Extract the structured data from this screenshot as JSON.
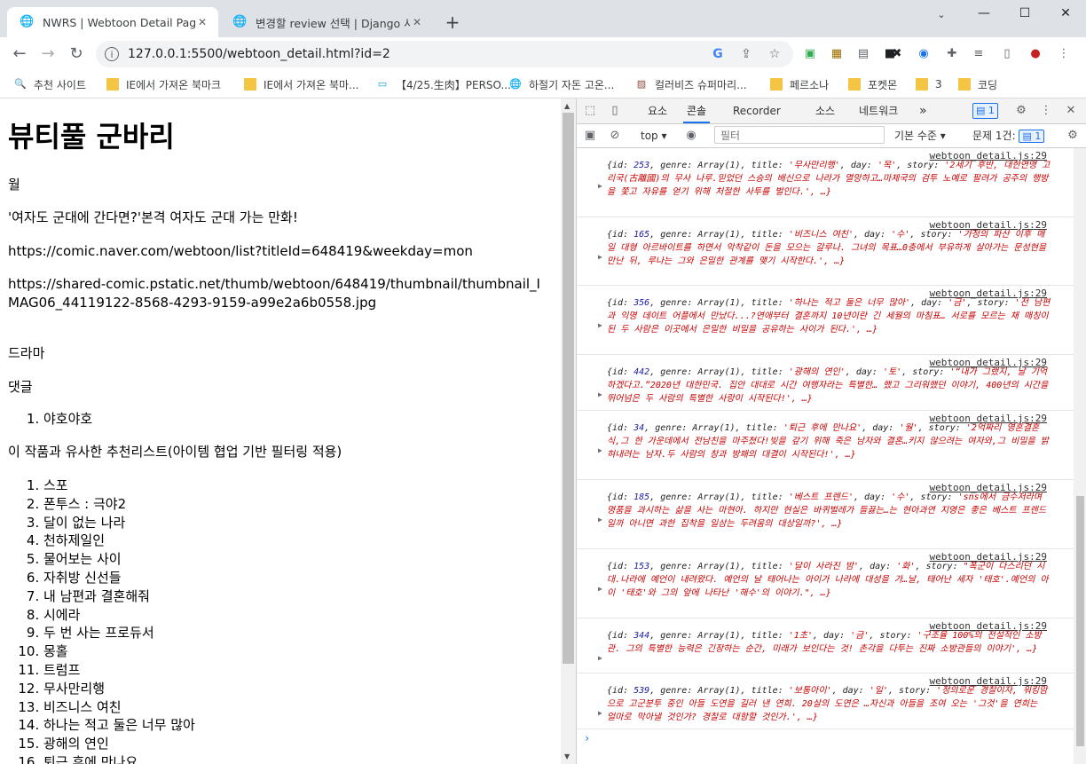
{
  "browser": {
    "tabs": [
      {
        "title": "NWRS | Webtoon Detail Page",
        "icon": "globe-icon",
        "active": true
      },
      {
        "title": "변경할 review 선택 | Django 사이트",
        "icon": "globe-icon",
        "active": false
      }
    ],
    "new_tab_symbol": "+",
    "window_controls": {
      "minimize": "—",
      "maximize": "☐",
      "close": "✕"
    },
    "url": "127.0.0.1:5500/webtoon_detail.html?id=2"
  },
  "bookmarks": [
    {
      "label": "추천 사이트",
      "icon": "search-icon"
    },
    {
      "label": "IE에서 가져온 북마크",
      "icon": "folder-icon"
    },
    {
      "label": "IE에서 가져온 북마...",
      "icon": "folder-icon"
    },
    {
      "label": "【4/25.生肉】PERSO...",
      "icon": "bilibili-icon"
    },
    {
      "label": "하절기 자돈 고온...",
      "icon": "globe-icon"
    },
    {
      "label": "컬러비즈 슈퍼마리...",
      "icon": "image-icon"
    },
    {
      "label": "페르소나",
      "icon": "folder-icon"
    },
    {
      "label": "포켓몬",
      "icon": "folder-icon"
    },
    {
      "label": "3",
      "icon": "folder-icon"
    },
    {
      "label": "코딩",
      "icon": "folder-icon"
    }
  ],
  "page": {
    "title": "뷰티풀 군바리",
    "day": "월",
    "story": "'여자도 군대에 간다면?'본격 여자도 군대 가는 만화!",
    "link": "https://comic.naver.com/webtoon/list?titleId=648419&weekday=mon",
    "thumbnail": "https://shared-comic.pstatic.net/thumb/webtoon/648419/thumbnail/thumbnail_IMAG06_44119122-8568-4293-9159-a99e2a6b0558.jpg",
    "genre": "드라마",
    "comments_heading": "댓글",
    "comments": [
      "야호야호"
    ],
    "recommend_heading": "이 작품과 유사한 추천리스트(아이템 협업 기반 필터링 적용)",
    "recommendations": [
      "스포",
      "폰투스 : 극야2",
      "달이 없는 나라",
      "천하제일인",
      "물어보는 사이",
      "자취방 신선들",
      "내 남편과 결혼해줘",
      "시에라",
      "두 번 사는 프로듀서",
      "몽홀",
      "트럼프",
      "무사만리행",
      "비즈니스 여친",
      "하나는 적고 둘은 너무 많아",
      "광해의 연인",
      "퇴근 후에 만나요"
    ]
  },
  "devtools": {
    "tabs": [
      "요소",
      "콘솔",
      "Recorder",
      "소스",
      "네트워크"
    ],
    "active_tab": "콘솔",
    "more_symbol": "»",
    "issue_count": "1",
    "context": "top",
    "filter_placeholder": "필터",
    "level": "기본 수준",
    "issues_label": "문제 1건:",
    "issues_count": "1",
    "prompt_symbol": "›",
    "console_entries": [
      {
        "source": "webtoon_detail.js:29",
        "id": "253",
        "genre": "Array(1)",
        "title": "'무사만리행'",
        "day": "'목'",
        "story": "'2세기 후반, 대한연맹 고리국(古離國)의 무사 나루.믿었던 스승의 배신으로 나라가 멸망하고…마제국의 검투 노예로 팔려가 공주의 행방을 쫓고 자유를 얻기 위해 처절한 사투를 벌인다.', …}"
      },
      {
        "source": "webtoon_detail.js:29",
        "id": "165",
        "genre": "Array(1)",
        "title": "'비즈니스 여친'",
        "day": "'수'",
        "story": "'가정의 파산 이후 매일 대형 아르바이트를 하면서 악착같이 돈을 모으는 갈루나. 그녀의 목표…0충에서 부유하게 살아가는 문성현을 만난 뒤, 루나는 그와 은밀한 관계를 맺기 시작한다.', …}"
      },
      {
        "source": "webtoon_detail.js:29",
        "id": "356",
        "genre": "Array(1)",
        "title": "'하나는 적고 둘은 너무 많아'",
        "day": "'금'",
        "story": "'전 남편과 익명 데이트 어플에서 만났다...?연애부터 결혼까지 10년이란 긴 세월의 마침표… 서로를 모르는 채 매칭이 된 두 사람은 이곳에서 은밀한 비밀을 공유하는 사이가 된다.', …}"
      },
      {
        "source": "webtoon_detail.js:29",
        "id": "442",
        "genre": "Array(1)",
        "title": "'광해의 연인'",
        "day": "'토'",
        "story": "'“내가 그랬지, 날 기억하겠다고.”2020년 대한민국. 집안 대대로 시간 여행자라는 특별한… 했고 그리워했던 이야기, 400년의 시간을 뛰어넘은 두 사람의 특별한 사랑이 시작된다!', …}"
      },
      {
        "source": "webtoon_detail.js:29",
        "id": "34",
        "genre": "Array(1)",
        "title": "'퇴근 후에 만나요'",
        "day": "'월'",
        "story": "'2억짜리 영혼결혼식,그 한 가운데에서 전남친을 마주쳤다!빚을 갚기 위해 죽은 남자와 결혼…키지 않으려는 여자와,그 비밀을 밝혀내려는 남자.두 사람의 창과 방패의 대결이 시작된다!', …}"
      },
      {
        "source": "webtoon_detail.js:29",
        "id": "185",
        "genre": "Array(1)",
        "title": "'베스트 프렌드'",
        "day": "'수'",
        "story": "'sns에서 금수저라며 명품을 과시하는 삶을 사는 마현아. 하지만 현실은 바퀴벌레가 들끓는…는 현아과연 지영은 좋은 베스트 프렌드일까 아니면 과한 집착을 일삼는 두려움의 대상일까?', …}"
      },
      {
        "source": "webtoon_detail.js:29",
        "id": "153",
        "genre": "Array(1)",
        "title": "'달이 사라진 밤'",
        "day": "'화'",
        "story": "\"폭군이 다스리던 시대.나라에 예언이 내려왔다. 예언의 날 태어나는 아이가 나라에 대성을 가…날, 태어난 세자 '태호'.예언의 아이 '태호'와 그의 앞에 나타난 '해수'의 이야기.\", …}"
      },
      {
        "source": "webtoon_detail.js:29",
        "id": "344",
        "genre": "Array(1)",
        "title": "'1초'",
        "day": "'금'",
        "story": "'구조율 100%의 전설적인 소방관.  그의 특별한 능력은 긴장하는 순간, 미래가 보인다는 것! 촌각을 다투는 진짜 소방관들의 이야기', …}"
      },
      {
        "source": "webtoon_detail.js:29",
        "id": "539",
        "genre": "Array(1)",
        "title": "'보통아이'",
        "day": "'일'",
        "story": "'정의로운 경찰이자, 워킹맘으로 고군분투 중인 아들 도연을 길러 낸 연희. 20살의 도연은 …자신과 아들을 조여 오는 '그것'을 연희는 얼마로 막아낼 것인가? 경찰로 대항할 것인가.', …}"
      }
    ]
  }
}
